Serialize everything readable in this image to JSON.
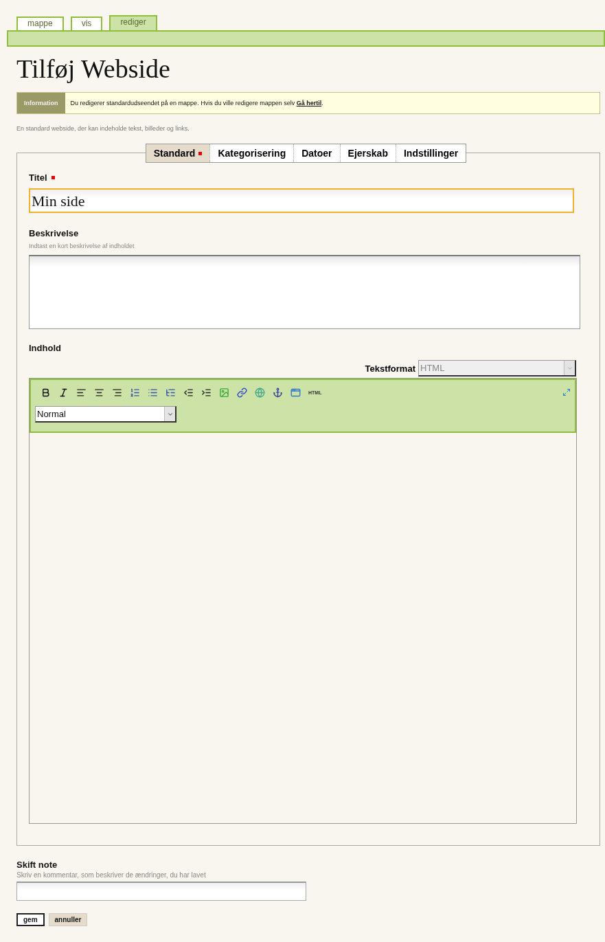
{
  "top_tabs": [
    {
      "label": "mappe",
      "selected": false
    },
    {
      "label": "vis",
      "selected": false
    },
    {
      "label": "rediger",
      "selected": true
    }
  ],
  "page_title": "Tilføj Webside",
  "info": {
    "label": "Information",
    "message": "Du redigerer standardudseendet på en mappe. Hvis du ville redigere mappen selv **Gå hertil**."
  },
  "description": "En standard webside, der kan indeholde tekst, billeder og links.",
  "form_tabs": [
    {
      "label": "Standard",
      "selected": true,
      "required": true
    },
    {
      "label": "Kategorisering",
      "selected": false,
      "required": false
    },
    {
      "label": "Datoer",
      "selected": false,
      "required": false
    },
    {
      "label": "Ejerskab",
      "selected": false,
      "required": false
    },
    {
      "label": "Indstillinger",
      "selected": false,
      "required": false
    }
  ],
  "titel": {
    "label": "Titel",
    "required": true,
    "value": "Min side"
  },
  "beskrivelse": {
    "label": "Beskrivelse",
    "hint": "Indtast en kort beskrivelse af indholdet"
  },
  "indhold": {
    "label": "Indhold",
    "format_label": "Tekstformat",
    "format_value": "HTML",
    "html_button": "HTML",
    "style_value": "Normal"
  },
  "skift_note": {
    "label": "Skift note",
    "hint": "Skriv en kommentar, som beskriver de ændringer, du har lavet"
  },
  "buttons": [
    {
      "label": "gem",
      "kind": "primary"
    },
    {
      "label": "annuller",
      "kind": "secondary"
    }
  ]
}
